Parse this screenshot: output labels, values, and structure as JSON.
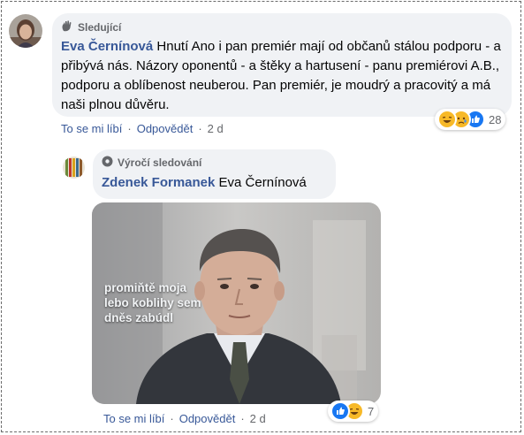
{
  "comment1": {
    "badge_label": "Sledující",
    "author": "Eva Černínová",
    "text": "Hnutí Ano i pan premiér mají od občanů stálou podporu - a přibývá nás. Názory oponentů - a štěky a hartusení - panu premiérovi A.B., podporu a oblíbenost neuberou. Pan premiér, je moudrý a pracovitý a má naši plnou důvěru.",
    "like_label": "To se mi líbí",
    "reply_label": "Odpovědět",
    "separator": "·",
    "time": "2 d",
    "reaction_count": "28",
    "reaction_icons": [
      "haha-icon",
      "sad-icon",
      "like-icon"
    ]
  },
  "comment2": {
    "badge_label": "Výročí sledování",
    "author": "Zdenek Formanek",
    "mention": "Eva Černínová",
    "image_caption": [
      "promiňtě moja",
      "lebo koblihy sem",
      "dněs zabúdl"
    ],
    "like_label": "To se mi líbí",
    "reply_label": "Odpovědět",
    "separator": "·",
    "time": "2 d",
    "reaction_count": "7",
    "reaction_icons": [
      "like-icon",
      "haha-icon"
    ]
  },
  "colors": {
    "author_link": "#385898",
    "bubble_bg": "#f0f2f5",
    "meta_gray": "#65676b",
    "like_blue": "#1877f2",
    "reaction_yellow": "#f7b928"
  }
}
